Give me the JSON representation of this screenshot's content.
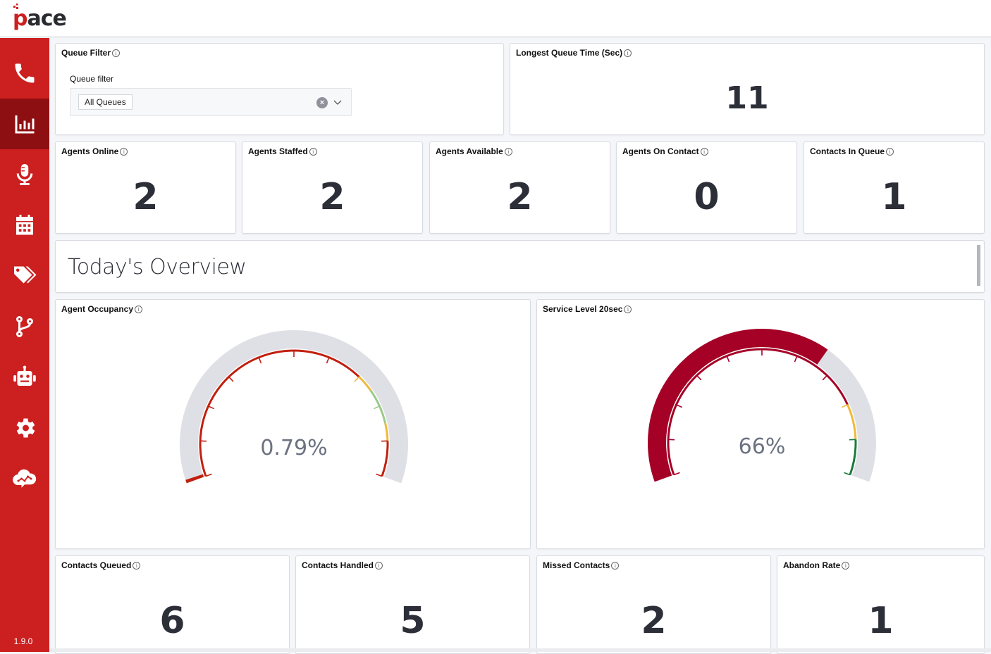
{
  "app": {
    "logo_text": "ace",
    "logo_letter": "p",
    "version": "1.9.0"
  },
  "sidebar": {
    "items": [
      {
        "name": "phone",
        "icon": "phone-icon",
        "active": false
      },
      {
        "name": "dashboard",
        "icon": "bar-chart-icon",
        "active": true
      },
      {
        "name": "recordings",
        "icon": "microphone-icon",
        "active": false
      },
      {
        "name": "calendar",
        "icon": "calendar-icon",
        "active": false
      },
      {
        "name": "tags",
        "icon": "tags-icon",
        "active": false
      },
      {
        "name": "flows",
        "icon": "branch-icon",
        "active": false
      },
      {
        "name": "bots",
        "icon": "robot-icon",
        "active": false
      },
      {
        "name": "settings",
        "icon": "gear-icon",
        "active": false
      },
      {
        "name": "analytics",
        "icon": "cloud-analytics-icon",
        "active": false
      }
    ]
  },
  "queue_filter": {
    "title": "Queue Filter",
    "label": "Queue filter",
    "selected": "All Queues"
  },
  "longest_queue": {
    "title": "Longest Queue Time (Sec)",
    "value": "11"
  },
  "stats_row": [
    {
      "title": "Agents Online",
      "value": "2"
    },
    {
      "title": "Agents Staffed",
      "value": "2"
    },
    {
      "title": "Agents Available",
      "value": "2"
    },
    {
      "title": "Agents On Contact",
      "value": "0"
    },
    {
      "title": "Contacts In Queue",
      "value": "1"
    }
  ],
  "overview": {
    "title": "Today's Overview"
  },
  "gauges": [
    {
      "title": "Agent Occupancy",
      "value_label": "0.79%",
      "value": 0.79,
      "min": 0,
      "max": 100,
      "fill_color": "#c0200f",
      "bands": [
        {
          "from": 0,
          "to": 70,
          "color": "#c0200f"
        },
        {
          "from": 70,
          "to": 75,
          "color": "#f0b93a"
        },
        {
          "from": 75,
          "to": 85,
          "color": "#9bc98a"
        },
        {
          "from": 85,
          "to": 90,
          "color": "#f0b93a"
        },
        {
          "from": 90,
          "to": 100,
          "color": "#c0200f"
        }
      ]
    },
    {
      "title": "Service Level 20sec",
      "value_label": "66%",
      "value": 66,
      "min": 0,
      "max": 100,
      "fill_color": "#a50026",
      "bands": [
        {
          "from": 0,
          "to": 80,
          "color": "#a50026"
        },
        {
          "from": 80,
          "to": 90,
          "color": "#f0b93a"
        },
        {
          "from": 90,
          "to": 100,
          "color": "#1a7a3c"
        }
      ]
    }
  ],
  "bottom_row": [
    {
      "title": "Contacts Queued",
      "value": "6"
    },
    {
      "title": "Contacts Handled",
      "value": "5"
    },
    {
      "title": "Missed Contacts",
      "value": "2"
    },
    {
      "title": "Abandon Rate",
      "value": "1"
    }
  ]
}
